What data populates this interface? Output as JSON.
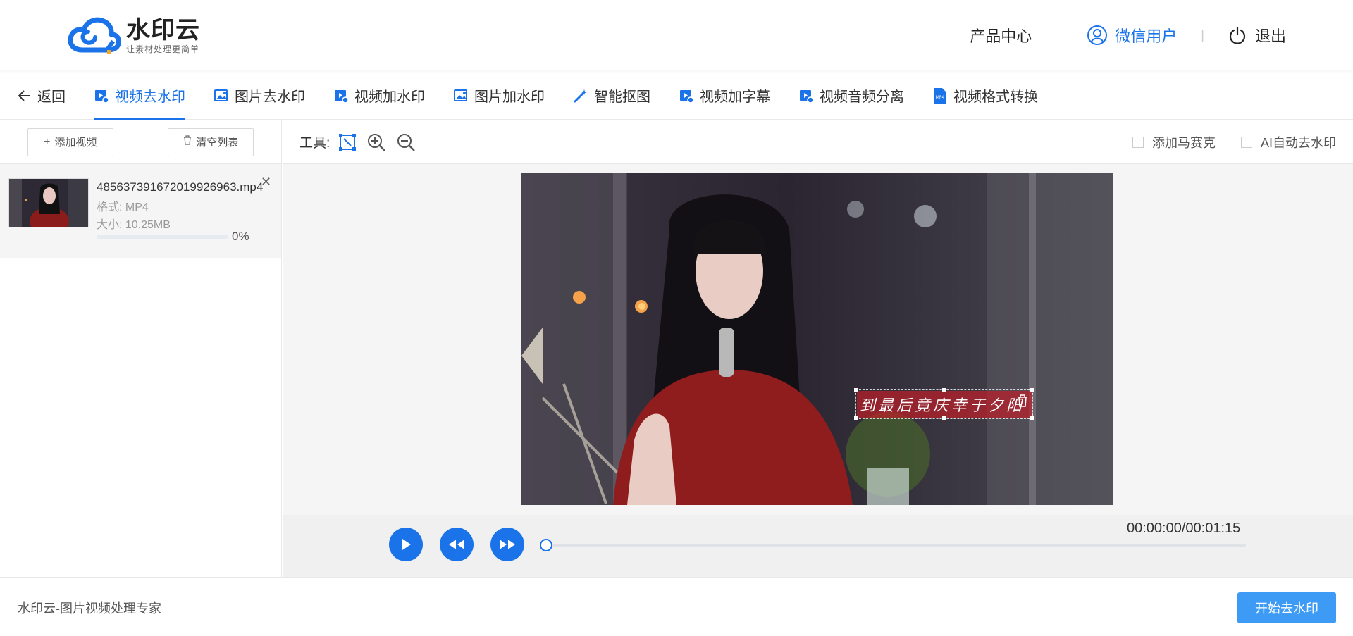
{
  "header": {
    "logo_title": "水印云",
    "logo_subtitle": "让素材处理更简单",
    "product_center": "产品中心",
    "user_name": "微信用户",
    "separator": "|",
    "logout": "退出",
    "colors": {
      "accent": "#1a73e8",
      "primary_button": "#3d9bf5"
    }
  },
  "tabs": {
    "back": "返回",
    "items": [
      {
        "label": "视频去水印",
        "icon": "video-icon",
        "active": true
      },
      {
        "label": "图片去水印",
        "icon": "image-icon"
      },
      {
        "label": "视频加水印",
        "icon": "video-icon"
      },
      {
        "label": "图片加水印",
        "icon": "image-icon"
      },
      {
        "label": "智能抠图",
        "icon": "magic-wand-icon"
      },
      {
        "label": "视频加字幕",
        "icon": "video-icon"
      },
      {
        "label": "视频音频分离",
        "icon": "video-icon"
      },
      {
        "label": "视频格式转换",
        "icon": "mp4-file-icon"
      }
    ]
  },
  "left_panel": {
    "add_video": "添加视频",
    "clear_list": "清空列表",
    "file": {
      "name": "485637391672019926963.mp4",
      "format": "格式: MP4",
      "size": "大小: 10.25MB",
      "progress": 0,
      "progress_text": "0%"
    }
  },
  "toolbar": {
    "label": "工具:",
    "icons": [
      "select-region-icon",
      "zoom-in-icon",
      "zoom-out-icon"
    ],
    "options": [
      {
        "label": "添加马赛克",
        "checked": false
      },
      {
        "label": "AI自动去水印",
        "checked": false
      }
    ]
  },
  "video": {
    "subtitle": "到最后竟庆幸于夕阳"
  },
  "player": {
    "time": "00:00:00/00:01:15",
    "position": 0
  },
  "footer": {
    "text": "水印云-图片视频处理专家",
    "start_button": "开始去水印"
  }
}
